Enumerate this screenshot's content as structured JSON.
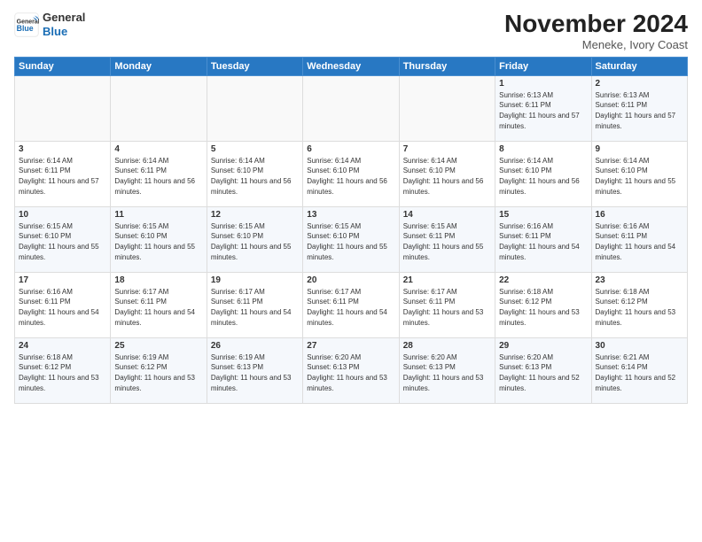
{
  "logo": {
    "general": "General",
    "blue": "Blue"
  },
  "header": {
    "title": "November 2024",
    "subtitle": "Meneke, Ivory Coast"
  },
  "days_of_week": [
    "Sunday",
    "Monday",
    "Tuesday",
    "Wednesday",
    "Thursday",
    "Friday",
    "Saturday"
  ],
  "weeks": [
    [
      {
        "day": "",
        "info": ""
      },
      {
        "day": "",
        "info": ""
      },
      {
        "day": "",
        "info": ""
      },
      {
        "day": "",
        "info": ""
      },
      {
        "day": "",
        "info": ""
      },
      {
        "day": "1",
        "info": "Sunrise: 6:13 AM\nSunset: 6:11 PM\nDaylight: 11 hours and 57 minutes."
      },
      {
        "day": "2",
        "info": "Sunrise: 6:13 AM\nSunset: 6:11 PM\nDaylight: 11 hours and 57 minutes."
      }
    ],
    [
      {
        "day": "3",
        "info": "Sunrise: 6:14 AM\nSunset: 6:11 PM\nDaylight: 11 hours and 57 minutes."
      },
      {
        "day": "4",
        "info": "Sunrise: 6:14 AM\nSunset: 6:11 PM\nDaylight: 11 hours and 56 minutes."
      },
      {
        "day": "5",
        "info": "Sunrise: 6:14 AM\nSunset: 6:10 PM\nDaylight: 11 hours and 56 minutes."
      },
      {
        "day": "6",
        "info": "Sunrise: 6:14 AM\nSunset: 6:10 PM\nDaylight: 11 hours and 56 minutes."
      },
      {
        "day": "7",
        "info": "Sunrise: 6:14 AM\nSunset: 6:10 PM\nDaylight: 11 hours and 56 minutes."
      },
      {
        "day": "8",
        "info": "Sunrise: 6:14 AM\nSunset: 6:10 PM\nDaylight: 11 hours and 56 minutes."
      },
      {
        "day": "9",
        "info": "Sunrise: 6:14 AM\nSunset: 6:10 PM\nDaylight: 11 hours and 55 minutes."
      }
    ],
    [
      {
        "day": "10",
        "info": "Sunrise: 6:15 AM\nSunset: 6:10 PM\nDaylight: 11 hours and 55 minutes."
      },
      {
        "day": "11",
        "info": "Sunrise: 6:15 AM\nSunset: 6:10 PM\nDaylight: 11 hours and 55 minutes."
      },
      {
        "day": "12",
        "info": "Sunrise: 6:15 AM\nSunset: 6:10 PM\nDaylight: 11 hours and 55 minutes."
      },
      {
        "day": "13",
        "info": "Sunrise: 6:15 AM\nSunset: 6:10 PM\nDaylight: 11 hours and 55 minutes."
      },
      {
        "day": "14",
        "info": "Sunrise: 6:15 AM\nSunset: 6:11 PM\nDaylight: 11 hours and 55 minutes."
      },
      {
        "day": "15",
        "info": "Sunrise: 6:16 AM\nSunset: 6:11 PM\nDaylight: 11 hours and 54 minutes."
      },
      {
        "day": "16",
        "info": "Sunrise: 6:16 AM\nSunset: 6:11 PM\nDaylight: 11 hours and 54 minutes."
      }
    ],
    [
      {
        "day": "17",
        "info": "Sunrise: 6:16 AM\nSunset: 6:11 PM\nDaylight: 11 hours and 54 minutes."
      },
      {
        "day": "18",
        "info": "Sunrise: 6:17 AM\nSunset: 6:11 PM\nDaylight: 11 hours and 54 minutes."
      },
      {
        "day": "19",
        "info": "Sunrise: 6:17 AM\nSunset: 6:11 PM\nDaylight: 11 hours and 54 minutes."
      },
      {
        "day": "20",
        "info": "Sunrise: 6:17 AM\nSunset: 6:11 PM\nDaylight: 11 hours and 54 minutes."
      },
      {
        "day": "21",
        "info": "Sunrise: 6:17 AM\nSunset: 6:11 PM\nDaylight: 11 hours and 53 minutes."
      },
      {
        "day": "22",
        "info": "Sunrise: 6:18 AM\nSunset: 6:12 PM\nDaylight: 11 hours and 53 minutes."
      },
      {
        "day": "23",
        "info": "Sunrise: 6:18 AM\nSunset: 6:12 PM\nDaylight: 11 hours and 53 minutes."
      }
    ],
    [
      {
        "day": "24",
        "info": "Sunrise: 6:18 AM\nSunset: 6:12 PM\nDaylight: 11 hours and 53 minutes."
      },
      {
        "day": "25",
        "info": "Sunrise: 6:19 AM\nSunset: 6:12 PM\nDaylight: 11 hours and 53 minutes."
      },
      {
        "day": "26",
        "info": "Sunrise: 6:19 AM\nSunset: 6:13 PM\nDaylight: 11 hours and 53 minutes."
      },
      {
        "day": "27",
        "info": "Sunrise: 6:20 AM\nSunset: 6:13 PM\nDaylight: 11 hours and 53 minutes."
      },
      {
        "day": "28",
        "info": "Sunrise: 6:20 AM\nSunset: 6:13 PM\nDaylight: 11 hours and 53 minutes."
      },
      {
        "day": "29",
        "info": "Sunrise: 6:20 AM\nSunset: 6:13 PM\nDaylight: 11 hours and 52 minutes."
      },
      {
        "day": "30",
        "info": "Sunrise: 6:21 AM\nSunset: 6:14 PM\nDaylight: 11 hours and 52 minutes."
      }
    ]
  ]
}
